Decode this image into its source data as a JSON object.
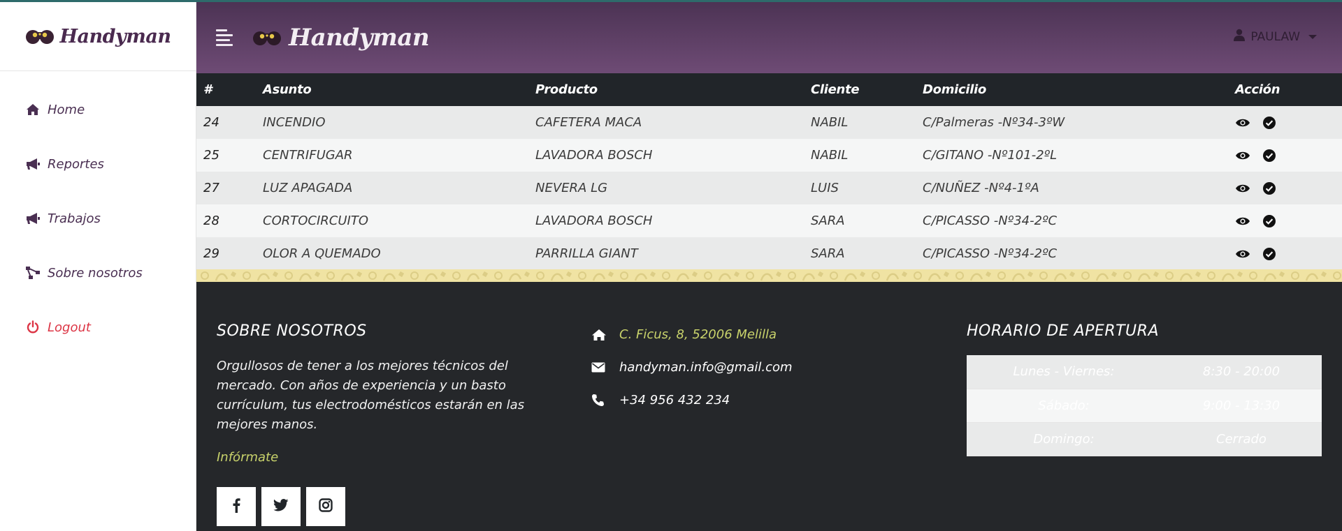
{
  "brand": {
    "name": "Handyman"
  },
  "header": {
    "user": "PAULAW"
  },
  "sidebar": {
    "items": [
      {
        "label": "Home",
        "icon": "home-icon"
      },
      {
        "label": "Reportes",
        "icon": "megaphone-icon"
      },
      {
        "label": "Trabajos",
        "icon": "megaphone-icon"
      },
      {
        "label": "Sobre nosotros",
        "icon": "network-icon"
      },
      {
        "label": "Logout",
        "icon": "power-icon"
      }
    ]
  },
  "table": {
    "headers": [
      "#",
      "Asunto",
      "Producto",
      "Cliente",
      "Domicilio",
      "Acción"
    ],
    "rows": [
      {
        "id": "24",
        "asunto": "INCENDIO",
        "producto": "CAFETERA MACA",
        "cliente": "NABIL",
        "domicilio": "C/Palmeras -Nº34-3ºW"
      },
      {
        "id": "25",
        "asunto": "CENTRIFUGAR",
        "producto": "LAVADORA BOSCH",
        "cliente": "NABIL",
        "domicilio": "C/GITANO -Nº101-2ºL"
      },
      {
        "id": "27",
        "asunto": "LUZ APAGADA",
        "producto": "NEVERA LG",
        "cliente": "LUIS",
        "domicilio": "C/NUÑEZ -Nº4-1ºA"
      },
      {
        "id": "28",
        "asunto": "CORTOCIRCUITO",
        "producto": "LAVADORA BOSCH",
        "cliente": "SARA",
        "domicilio": "C/PICASSO -Nº34-2ºC"
      },
      {
        "id": "29",
        "asunto": "OLOR A QUEMADO",
        "producto": "PARRILLA GIANT",
        "cliente": "SARA",
        "domicilio": "C/PICASSO -Nº34-2ºC"
      }
    ]
  },
  "footer": {
    "about": {
      "title": "SOBRE NOSOTROS",
      "text": "Orgullosos de tener a los mejores técnicos del mercado. Con años de experiencia y un basto currículum, tus electrodomésticos estarán en las mejores manos.",
      "link": "Infórmate"
    },
    "contact": {
      "address": "C. Ficus, 8, 52006 Melilla",
      "email": "handyman.info@gmail.com",
      "phone": "+34 956 432 234"
    },
    "hours": {
      "title": "HORARIO DE APERTURA",
      "rows": [
        {
          "day": "Lunes - Viernes:",
          "time": "8:30 - 20:00"
        },
        {
          "day": "Sábado:",
          "time": "9:00 - 13:30"
        },
        {
          "day": "Domingo:",
          "time": "Cerrado"
        }
      ]
    }
  },
  "colors": {
    "header_gradient_top": "#4c3354",
    "header_gradient_bottom": "#6e4b75",
    "brand_purple": "#4a2a4f",
    "table_head": "#212529",
    "footer_bg": "#25272a",
    "accent_yellow": "#c8d26b",
    "logout_red": "#dc3545"
  }
}
